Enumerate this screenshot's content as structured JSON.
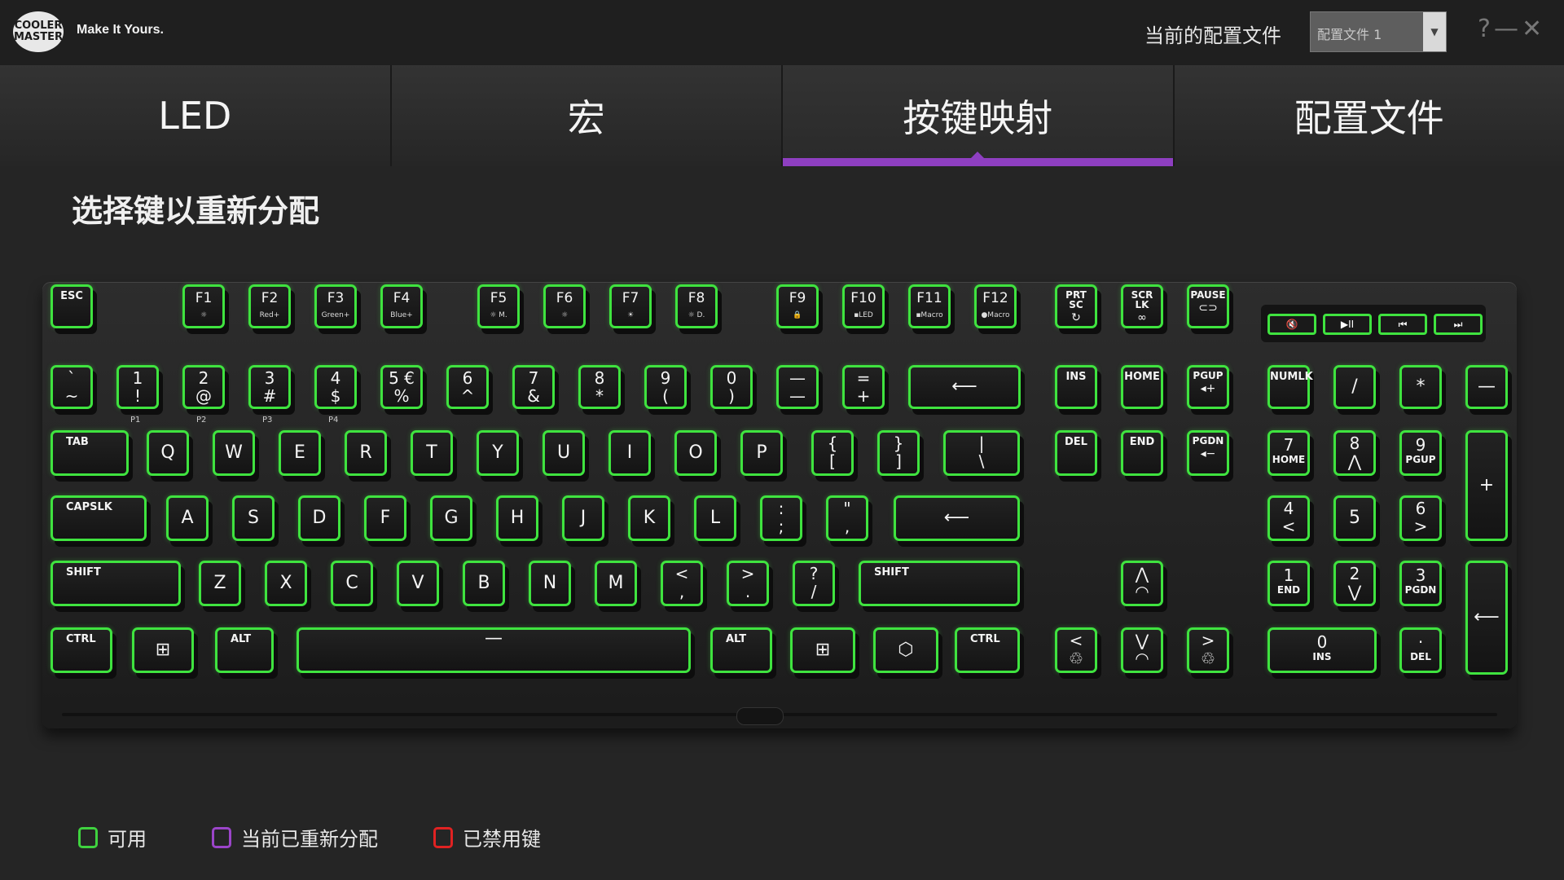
{
  "app": {
    "logo_text": "COOLER MASTER",
    "tagline": "Make It Yours.",
    "profile_label": "当前的配置文件",
    "profile_value": "配置文件 1",
    "help": "?",
    "minimize": "—",
    "close": "✕"
  },
  "tabs": [
    {
      "label": "LED"
    },
    {
      "label": "宏"
    },
    {
      "label": "按键映射",
      "active": true
    },
    {
      "label": "配置文件"
    }
  ],
  "heading": "选择键以重新分配",
  "keys": {
    "esc": "ESC",
    "f1": "F1",
    "f1_sub": "☼",
    "f2": "F2",
    "f2_sub": "Red+",
    "f3": "F3",
    "f3_sub": "Green+",
    "f4": "F4",
    "f4_sub": "Blue+",
    "f5": "F5",
    "f5_sub": "☼ M.",
    "f6": "F6",
    "f6_sub": "☼",
    "f7": "F7",
    "f7_sub": "☀",
    "f8": "F8",
    "f8_sub": "☼ D.",
    "f9": "F9",
    "f9_sub": "🔒",
    "f10": "F10",
    "f10_sub": "▪LED",
    "f11": "F11",
    "f11_sub": "▪Macro",
    "f12": "F12",
    "f12_sub": "●Macro",
    "prtsc": "PRT SC",
    "prtsc_sub": "↻",
    "scrlk": "SCR LK",
    "scrlk_sub": "∞",
    "pause": "PAUSE",
    "pause_sub": "⊂⊃",
    "media": [
      "🔇",
      "▶II",
      "⏮",
      "⏭"
    ],
    "grave_top": "`",
    "grave_bot": "~",
    "n1_top": "1",
    "n1_bot": "!",
    "n1_sub": "P1",
    "n2_top": "2",
    "n2_bot": "@",
    "n2_sub": "P2",
    "n3_top": "3",
    "n3_bot": "#",
    "n3_sub": "P3",
    "n4_top": "4",
    "n4_bot": "$",
    "n4_sub": "P4",
    "n5_top": "5 €",
    "n5_bot": "%",
    "n6_top": "6",
    "n6_bot": "^",
    "n7_top": "7",
    "n7_bot": "&",
    "n8_top": "8",
    "n8_bot": "*",
    "n9_top": "9",
    "n9_bot": "(",
    "n0_top": "0",
    "n0_bot": ")",
    "minus_top": "—",
    "minus_bot": "—",
    "equal_top": "=",
    "equal_bot": "+",
    "backspace": "⟵",
    "ins": "INS",
    "home": "HOME",
    "pgup": "PGUP",
    "pgup_sub": "◂+",
    "numlk": "NUMLK",
    "np_slash": "/",
    "np_star": "*",
    "np_minus": "—",
    "tab": "TAB",
    "q": "Q",
    "w": "W",
    "e": "E",
    "r": "R",
    "t": "T",
    "y": "Y",
    "u": "U",
    "i": "I",
    "o": "O",
    "p": "P",
    "lbrace_top": "{",
    "lbrace_bot": "[",
    "rbrace_top": "}",
    "rbrace_bot": "]",
    "pipe_top": "|",
    "pipe_bot": "\\",
    "del": "DEL",
    "end": "END",
    "pgdn": "PGDN",
    "pgdn_sub": "◂−",
    "np7_top": "7",
    "np7_bot": "HOME",
    "np8_top": "8",
    "np8_bot": "⋀",
    "np9_top": "9",
    "np9_bot": "PGUP",
    "np_plus": "+",
    "capslk": "CAPSLK",
    "a": "A",
    "s": "S",
    "d": "D",
    "f": "F",
    "g": "G",
    "h": "H",
    "j": "J",
    "k": "K",
    "l": "L",
    "semi_top": ":",
    "semi_bot": ";",
    "quote_top": "\"",
    "quote_bot": ",",
    "enter": "⟵",
    "np4_top": "4",
    "np4_bot": "<",
    "np5": "5",
    "np6_top": "6",
    "np6_bot": ">",
    "lshift": "SHIFT",
    "z": "Z",
    "x": "X",
    "c": "C",
    "v": "V",
    "b": "B",
    "n": "N",
    "m": "M",
    "comma_top": "<",
    "comma_bot": ",",
    "period_top": ">",
    "period_bot": ".",
    "slash_top": "?",
    "slash_bot": "/",
    "rshift": "SHIFT",
    "up": "⋀",
    "up_sub": "◠",
    "np1_top": "1",
    "np1_bot": "END",
    "np2_top": "2",
    "np2_bot": "⋁",
    "np3_top": "3",
    "np3_bot": "PGDN",
    "np_enter": "⟵",
    "lctrl": "CTRL",
    "lwin": "⊞",
    "lalt": "ALT",
    "space": "—",
    "ralt": "ALT",
    "rwin": "⊞",
    "fnlogo": "⬡",
    "rctrl": "CTRL",
    "left": "<",
    "left_sub": "♲",
    "down": "⋁",
    "down_sub": "◠",
    "right": ">",
    "right_sub": "♲",
    "np0_top": "0",
    "np0_bot": "INS",
    "npdot_top": "·",
    "npdot_bot": "DEL"
  },
  "legend": [
    {
      "label": "可用",
      "color": "#3fd23f"
    },
    {
      "label": "当前已重新分配",
      "color": "#9b45c9"
    },
    {
      "label": "已禁用键",
      "color": "#e02222"
    }
  ]
}
